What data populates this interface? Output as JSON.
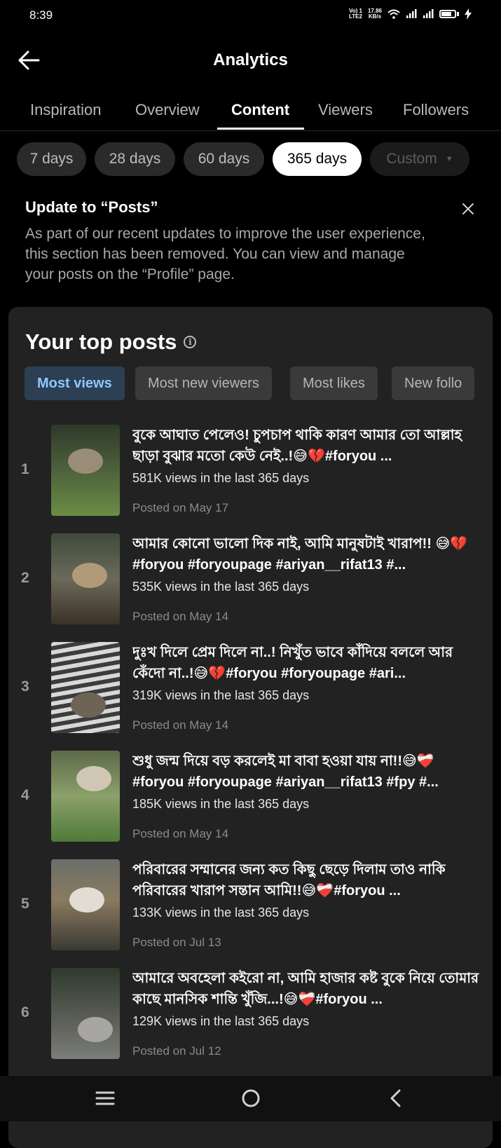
{
  "status_bar": {
    "time": "8:39",
    "network_top": "Vo) 1",
    "network_bottom": "LTE2",
    "speed_top": "17.86",
    "speed_bottom": "KB/s"
  },
  "header": {
    "title": "Analytics"
  },
  "tabs": [
    {
      "label": "Inspiration"
    },
    {
      "label": "Overview"
    },
    {
      "label": "Content"
    },
    {
      "label": "Viewers"
    },
    {
      "label": "Followers"
    }
  ],
  "active_tab": "Content",
  "date_ranges": [
    {
      "label": "7 days"
    },
    {
      "label": "28 days"
    },
    {
      "label": "60 days"
    },
    {
      "label": "365 days"
    },
    {
      "label": "Custom"
    }
  ],
  "selected_range": "365 days",
  "notice": {
    "title": "Update to “Posts”",
    "body": "As part of our recent updates to improve the user experience, this section has been removed. You can view and manage your posts on the “Profile” page."
  },
  "top_posts": {
    "title": "Your top posts",
    "filters": [
      {
        "label": "Most views"
      },
      {
        "label": "Most new viewers"
      },
      {
        "label": "Most likes"
      },
      {
        "label": "New follo"
      }
    ],
    "selected_filter": "Most views",
    "posts": [
      {
        "rank": "1",
        "caption": "বুকে আঘাত পেলেও! চুপচাপ থাকি কারণ আমার তো আল্লাহ ছাড়া বুঝার মতো কেউ নেই..!😅💔#foryou ...",
        "views": "581K views in the last 365 days",
        "posted": "Posted on May 17"
      },
      {
        "rank": "2",
        "caption": "আমার কোনো ভালো দিক নাই, আমি মানুষটাই খারাপ!! 😅💔#foryou #foryoupage #ariyan__rifat13 #...",
        "views": "535K views in the last 365 days",
        "posted": "Posted on May 14"
      },
      {
        "rank": "3",
        "caption": "দুঃখ দিলে প্রেম দিলে না..! নিখুঁত ভাবে কাঁদিয়ে বললে আর কেঁদো না..!😅💔#foryou #foryoupage #ari...",
        "views": "319K views in the last 365 days",
        "posted": "Posted on May 14"
      },
      {
        "rank": "4",
        "caption": "শুধু জন্ম দিয়ে বড় করলেই মা বাবা হওয়া যায় না!!😅❤️‍🩹 #foryou #foryoupage #ariyan__rifat13 #fpy #...",
        "views": "185K views in the last 365 days",
        "posted": "Posted on May 14"
      },
      {
        "rank": "5",
        "caption": "পরিবারের সম্মানের জন্য কত কিছু ছেড়ে দিলাম তাও নাকি পরিবারের খারাপ সন্তান আমি!!😅❤️‍🩹#foryou ...",
        "views": "133K views in the last 365 days",
        "posted": "Posted on Jul 13"
      },
      {
        "rank": "6",
        "caption": "আমারে অবহেলা কইরো না, আমি হাজার কষ্ট বুকে নিয়ে তোমার কাছে মানসিক শান্তি খুঁজি...!😅❤️‍🩹#foryou ...",
        "views": "129K views in the last 365 days",
        "posted": "Posted on Jul 12"
      }
    ]
  },
  "colors": {
    "background": "#000000",
    "card": "#222222",
    "selected_chip_bg": "#2d3f53",
    "selected_chip_text": "#8cc8ff"
  },
  "icons": {
    "back": "arrow-left-icon",
    "close": "close-icon",
    "info": "info-icon",
    "nav_menu": "menu-icon",
    "nav_home": "home-circle-icon",
    "nav_back": "chevron-left-icon"
  }
}
